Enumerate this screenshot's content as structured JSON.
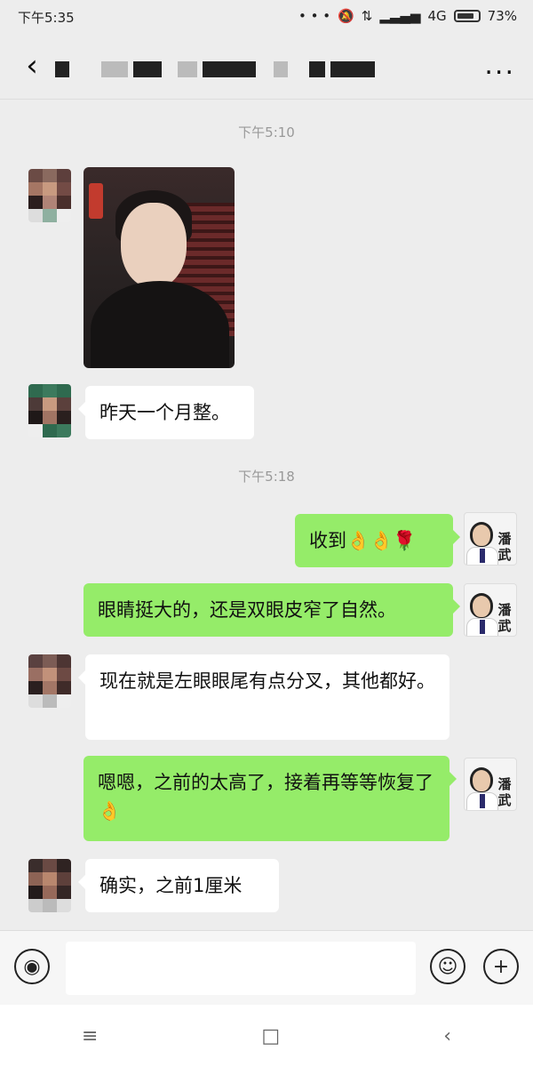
{
  "status_bar": {
    "time": "下午5:35",
    "signal": "4G",
    "battery": "73%"
  },
  "header": {
    "back_icon": "chevron-left-icon",
    "more_label": "..."
  },
  "messages": [
    {
      "type": "timestamp",
      "text": "下午5:10"
    },
    {
      "type": "image",
      "side": "left"
    },
    {
      "type": "text",
      "side": "left",
      "text": "昨天一个月整。"
    },
    {
      "type": "timestamp",
      "text": "下午5:18"
    },
    {
      "type": "text",
      "side": "right",
      "text": "收到👌👌🌹"
    },
    {
      "type": "text",
      "side": "right",
      "text": "眼睛挺大的，还是双眼皮窄了自然。"
    },
    {
      "type": "text",
      "side": "left",
      "text": "现在就是左眼眼尾有点分叉，其他都好。"
    },
    {
      "type": "text",
      "side": "right",
      "text": "嗯嗯，之前的太高了，接着再等等恢复了👌"
    },
    {
      "type": "text",
      "side": "left",
      "text": "确实，之前1厘米"
    }
  ],
  "doctor_avatar_text": "潘武",
  "input_bar": {
    "voice_icon": "voice-icon",
    "emoji_icon": "emoji-icon",
    "plus_icon": "plus-icon",
    "placeholder": ""
  },
  "nav_bar": {
    "menu": "≡",
    "home": "□",
    "back": "‹"
  }
}
